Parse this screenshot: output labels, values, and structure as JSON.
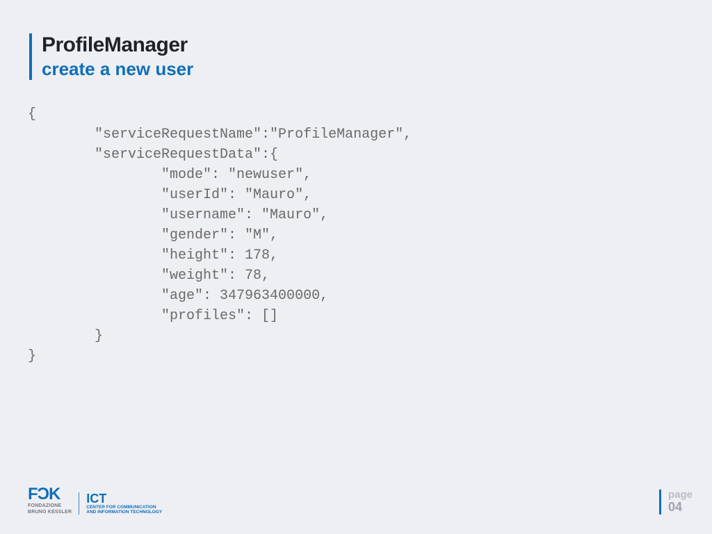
{
  "title": {
    "main": "ProfileManager",
    "sub": "create a new user"
  },
  "code": "{\n        \"serviceRequestName\":\"ProfileManager\",\n        \"serviceRequestData\":{\n                \"mode\": \"newuser\",\n                \"userId\": \"Mauro\",\n                \"username\": \"Mauro\",\n                \"gender\": \"M\",\n                \"height\": 178,\n                \"weight\": 78,\n                \"age\": 347963400000,\n                \"profiles\": []\n        }\n}",
  "footer": {
    "fbk_glyph": "FƆK",
    "fbk_line1": "FONDAZIONE",
    "fbk_line2": "BRUNO KESSLER",
    "ict_big": "ICT",
    "ict_line1": "CENTER FOR COMMUNICATION",
    "ict_line2": "AND INFORMATION TECHNOLOGY",
    "page_label": "page",
    "page_number": "04"
  }
}
